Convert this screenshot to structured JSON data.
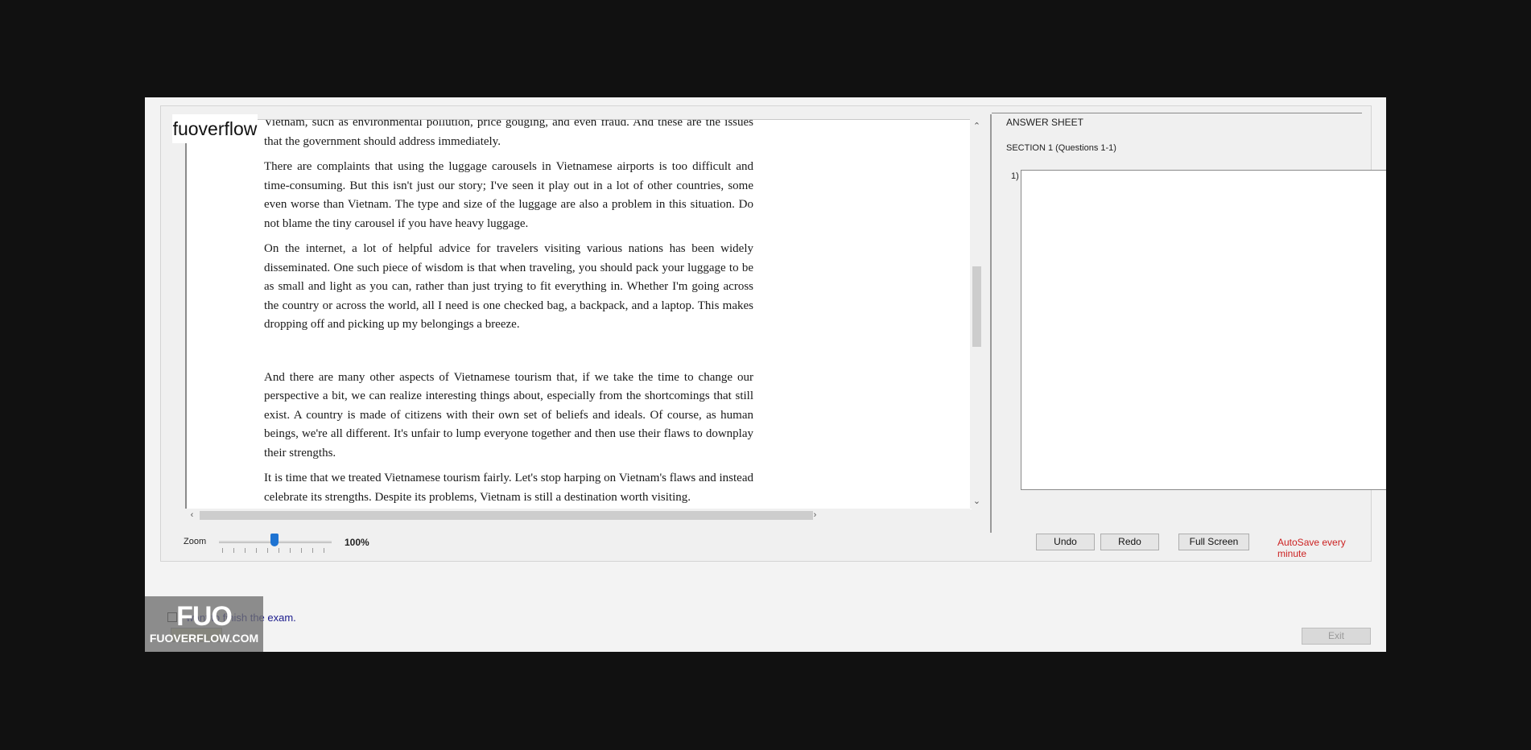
{
  "logo": {
    "text": "fuoverflow"
  },
  "passage": {
    "paragraphs": [
      "Vietnam, such as environmental pollution, price gouging, and even fraud. And these are the issues that the government should address immediately.",
      "There are complaints that using the luggage carousels in Vietnamese airports is too difficult and time-consuming. But this isn't just our story; I've seen it play out in a lot of other countries, some even worse than Vietnam. The type and size of the luggage are also a problem in this situation. Do not blame the tiny carousel if you have heavy luggage.",
      "On the internet, a lot of helpful advice for travelers visiting various nations has been widely disseminated. One such piece of wisdom is that when traveling, you should pack your luggage to be as small and light as you can, rather than just trying to fit everything in. Whether I'm going across the country or across the world, all I need is one checked bag, a backpack, and a laptop. This makes dropping off and picking up my belongings a breeze.",
      "And there are many other aspects of Vietnamese tourism that, if we take the time to change our perspective a bit, we can realize interesting things about, especially from the shortcomings that still exist. A country is made of citizens with their own set of beliefs and ideals. Of course, as human beings, we're all different. It's unfair to lump everyone together and then use their flaws to downplay their strengths.",
      "It is time that we treated Vietnamese tourism fairly. Let's stop harping on Vietnam's flaws and instead celebrate its strengths. Despite its problems, Vietnam is still a destination worth visiting."
    ]
  },
  "answer_sheet": {
    "title": "ANSWER SHEET",
    "section": "SECTION 1 (Questions 1-1)",
    "question_number": "1)"
  },
  "zoom": {
    "label": "Zoom",
    "value": "100%",
    "level_percent": 100
  },
  "toolbar": {
    "undo": "Undo",
    "redo": "Redo",
    "full_screen": "Full Screen",
    "autosave": "AutoSave every minute"
  },
  "footer": {
    "finish_text": "I want to finish the exam.",
    "exit": "Exit"
  },
  "watermark": {
    "big": "FUO",
    "small": "FUOVERFLOW.COM"
  },
  "colors": {
    "autosave": "#cc2222",
    "zoom_thumb": "#1e73d2",
    "finish_text": "#1a1a8c"
  }
}
